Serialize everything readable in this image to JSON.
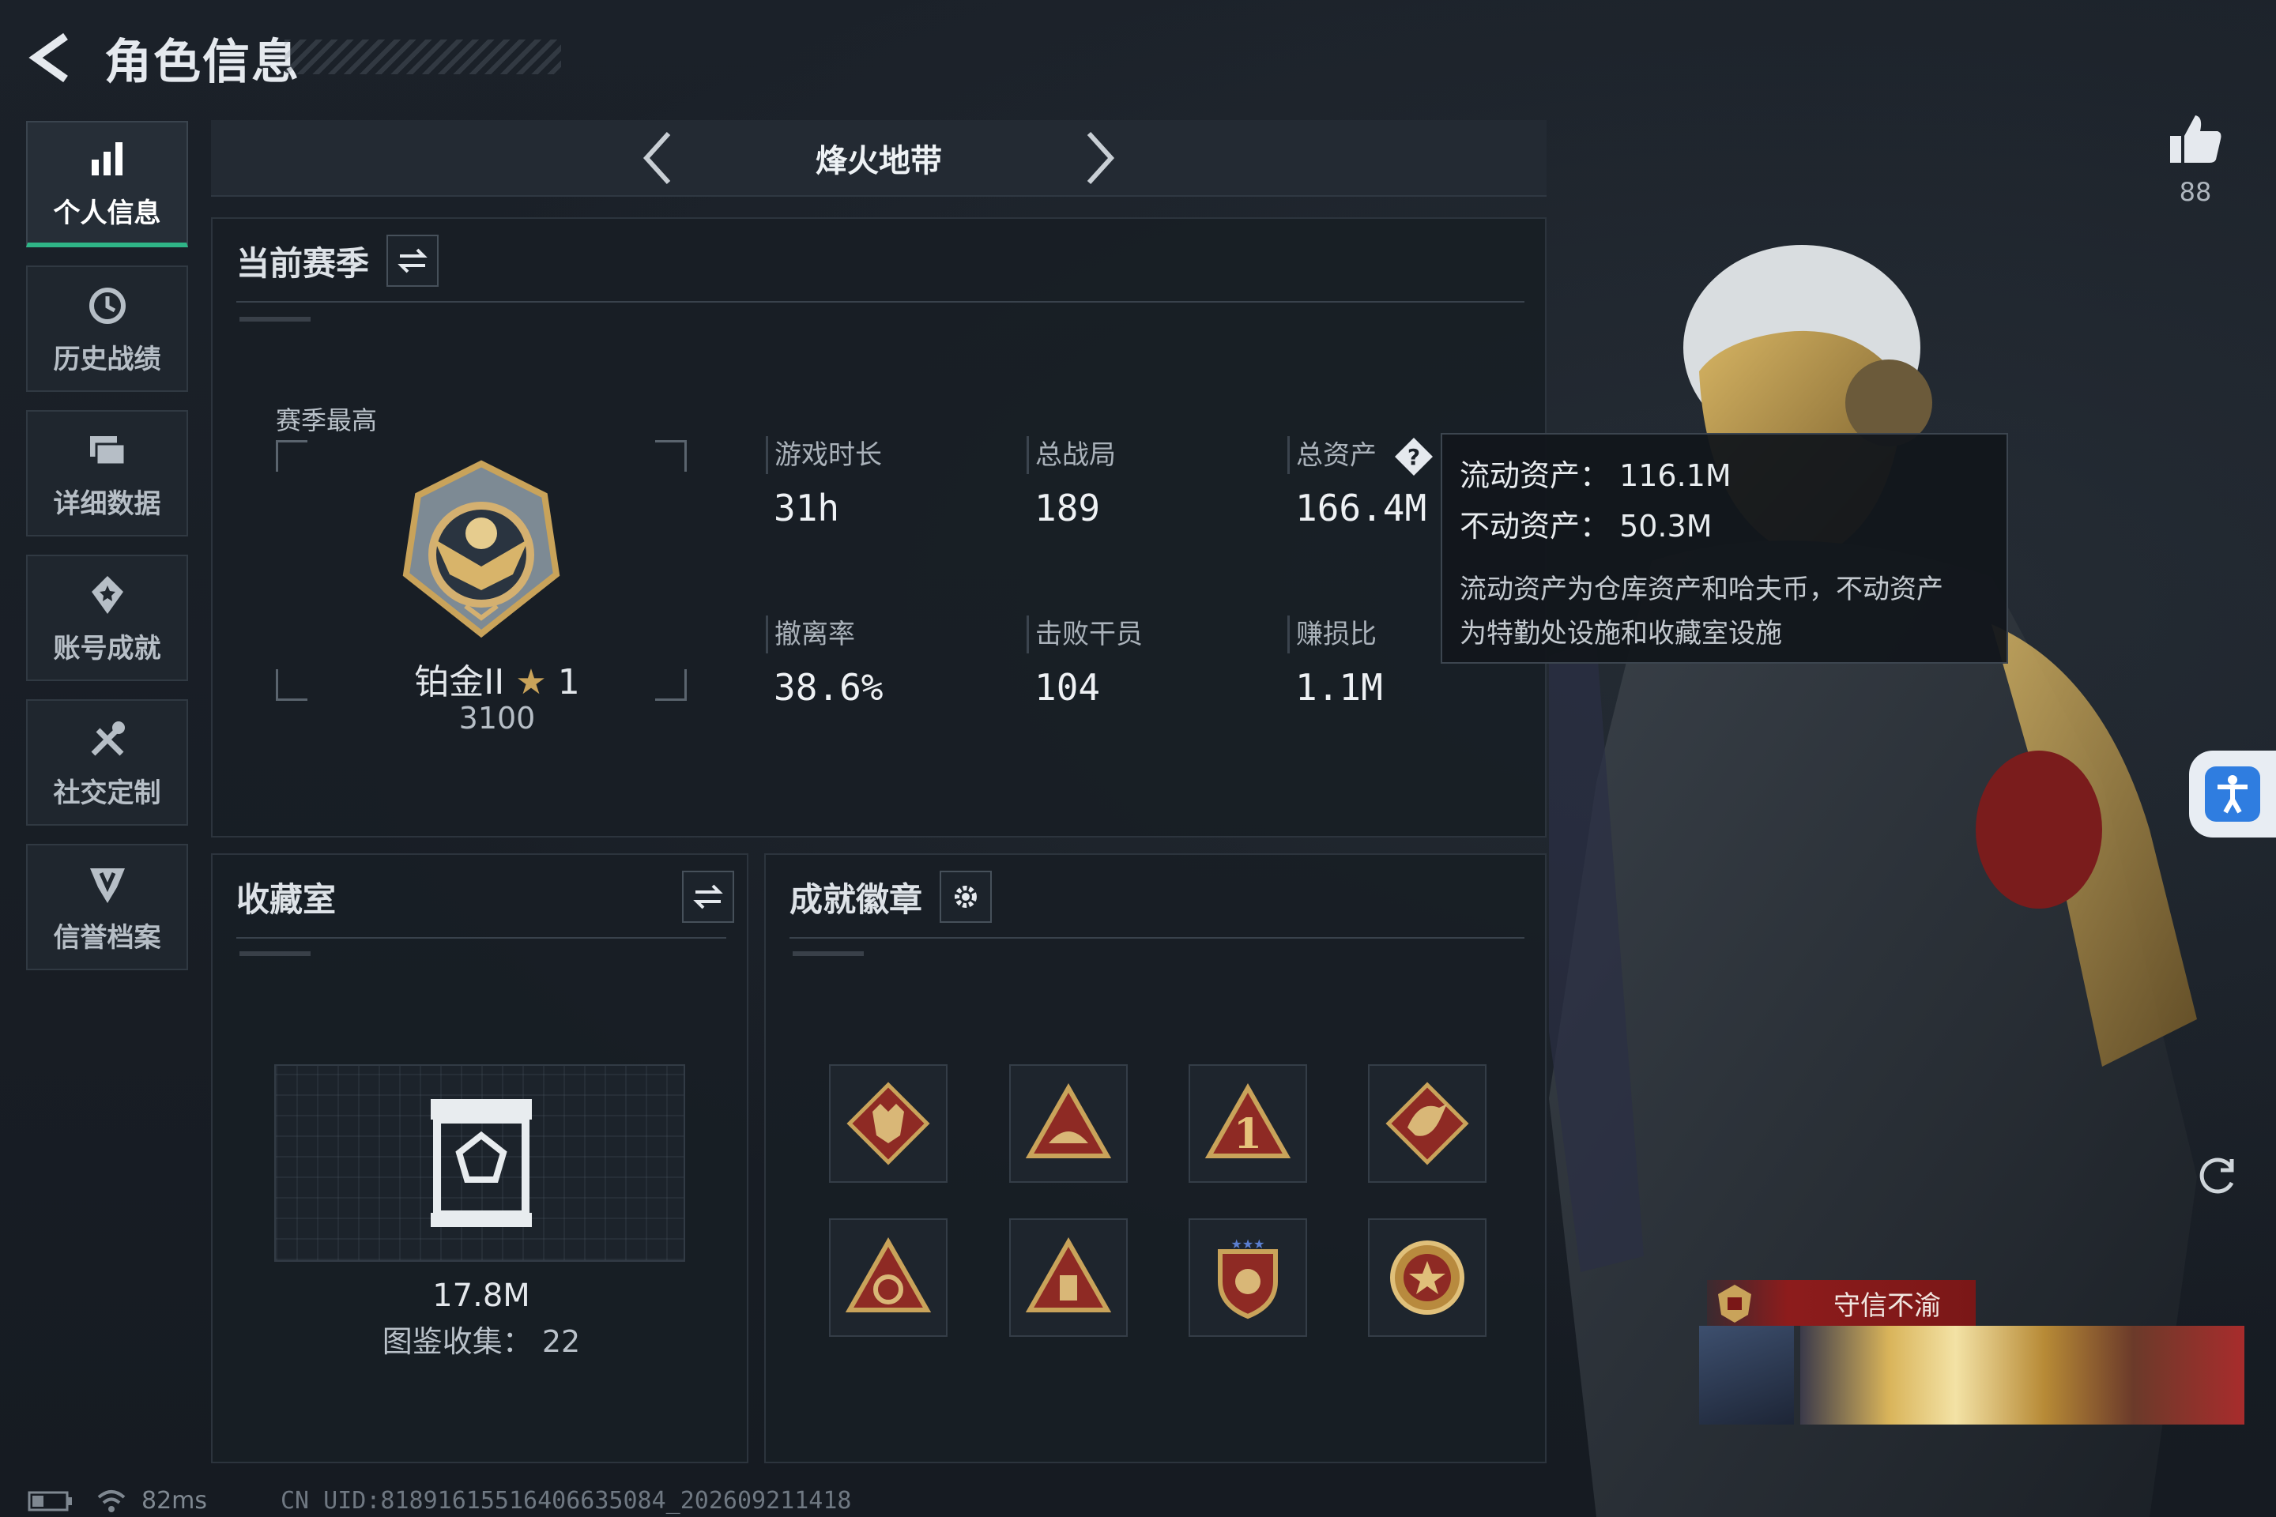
{
  "header": {
    "title": "角色信息"
  },
  "sidebar": {
    "items": [
      {
        "label": "个人信息",
        "icon": "bar-chart-icon",
        "active": true
      },
      {
        "label": "历史战绩",
        "icon": "history-icon"
      },
      {
        "label": "详细数据",
        "icon": "cards-icon"
      },
      {
        "label": "账号成就",
        "icon": "achievement-icon"
      },
      {
        "label": "社交定制",
        "icon": "tools-icon"
      },
      {
        "label": "信誉档案",
        "icon": "credit-shield-icon"
      }
    ]
  },
  "mode": {
    "title": "烽火地带"
  },
  "season": {
    "title": "当前赛季",
    "best_label": "赛季最高",
    "rank_name": "铂金II",
    "rank_stars": "1",
    "rank_score": "3100",
    "stats": [
      {
        "label": "游戏时长",
        "value": "31h"
      },
      {
        "label": "总战局",
        "value": "189"
      },
      {
        "label": "总资产",
        "value": "166.4M"
      },
      {
        "label": "撤离率",
        "value": "38.6%"
      },
      {
        "label": "击败干员",
        "value": "104"
      },
      {
        "label": "赚损比",
        "value": "1.1M"
      }
    ]
  },
  "tooltip": {
    "liquid": "流动资产：  116.1M",
    "fixed": "不动资产：  50.3M",
    "desc_line1": "流动资产为仓库资产和哈夫币，不动资产",
    "desc_line2": "为特勤处设施和收藏室设施"
  },
  "collection": {
    "title": "收藏室",
    "value": "17.8M",
    "count": "图鉴收集：  22"
  },
  "badges": {
    "title": "成就徽章"
  },
  "profile": {
    "likes": "88",
    "honor_title": "守信不渝"
  },
  "status": {
    "ping": "82ms",
    "uid": "CN UID:8189161551640663508​4_202609211418"
  },
  "colors": {
    "accent": "#2fb587",
    "banner": "#8d1c1c",
    "gold": "#c9a35a"
  }
}
